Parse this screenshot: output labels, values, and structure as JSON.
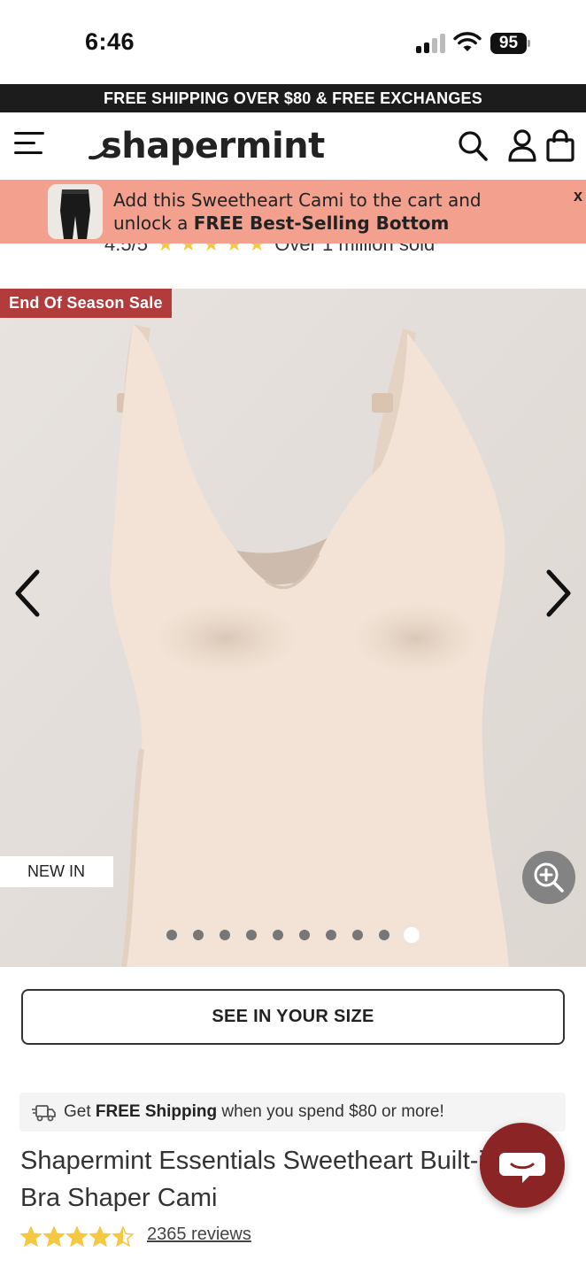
{
  "status_bar": {
    "time": "6:46",
    "battery": "95"
  },
  "announcement": {
    "text": "FREE SHIPPING OVER $80 & FREE EXCHANGES"
  },
  "header": {
    "logo_text": "shapermint",
    "icons": [
      "menu-icon",
      "search-icon",
      "account-icon",
      "cart-icon"
    ]
  },
  "promo": {
    "line1": "Add this Sweetheart Cami to the cart and",
    "line2_prefix": "unlock a ",
    "line2_bold": "FREE Best-Selling Bottom",
    "close": "x"
  },
  "peek_rating": {
    "score": "4.5/5",
    "sold": "Over 1 million sold"
  },
  "gallery": {
    "sale_badge": "End Of Season Sale",
    "new_badge": "NEW IN",
    "dot_count": 10,
    "active_dot_index": 9
  },
  "size_button": {
    "label": "SEE IN YOUR SIZE"
  },
  "shipping_notice": {
    "prefix": "Get ",
    "bold": "FREE Shipping",
    "suffix": " when you spend $80 or more!"
  },
  "product": {
    "title_line1": "Shapermint Essentials Sweetheart Built-in",
    "title_line2": "Bra Shaper Cami",
    "rating_value": 4.5,
    "reviews_label": "2365 reviews"
  },
  "colors": {
    "announcement_bg": "#1c1c1c",
    "promo_bg": "#f3a08e",
    "sale_badge_bg": "#b23b3b",
    "chat_bg": "#8b2525",
    "star": "#f5c842",
    "image_bg": "#e6e1dd",
    "garment": "#f2e3d6"
  }
}
